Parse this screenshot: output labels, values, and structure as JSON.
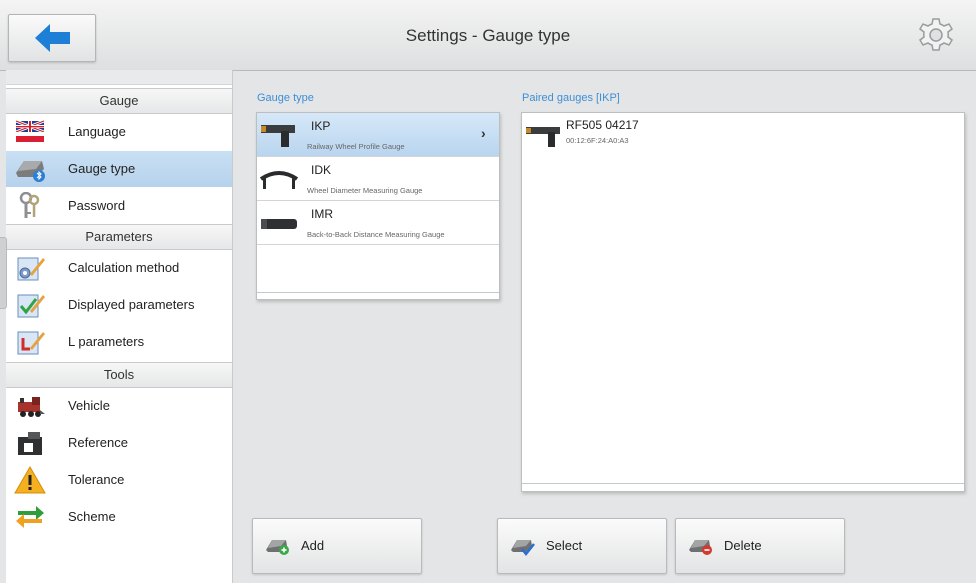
{
  "header": {
    "title": "Settings - Gauge type"
  },
  "sidebar": {
    "sections": [
      {
        "title": "Gauge",
        "items": [
          {
            "label": "Language",
            "icon": "uk-flag-icon"
          },
          {
            "label": "Gauge type",
            "icon": "gauge-bluetooth-icon",
            "selected": true
          },
          {
            "label": "Password",
            "icon": "keys-icon"
          }
        ]
      },
      {
        "title": "Parameters",
        "items": [
          {
            "label": "Calculation method",
            "icon": "calculation-method-icon"
          },
          {
            "label": "Displayed parameters",
            "icon": "displayed-parameters-icon"
          },
          {
            "label": "L parameters",
            "icon": "l-parameters-icon"
          }
        ]
      },
      {
        "title": "Tools",
        "items": [
          {
            "label": "Vehicle",
            "icon": "locomotive-icon"
          },
          {
            "label": "Reference",
            "icon": "reference-icon"
          },
          {
            "label": "Tolerance",
            "icon": "warning-icon"
          },
          {
            "label": "Scheme",
            "icon": "scheme-arrows-icon"
          }
        ]
      }
    ]
  },
  "gauge_type": {
    "label": "Gauge type",
    "items": [
      {
        "name": "IKP",
        "description": "Railway Wheel Profile Gauge",
        "selected": true
      },
      {
        "name": "IDK",
        "description": "Wheel Diameter Measuring Gauge"
      },
      {
        "name": "IMR",
        "description": "Back-to-Back Distance Measuring Gauge"
      }
    ]
  },
  "paired": {
    "label": "Paired gauges [IKP]",
    "items": [
      {
        "name": "RF505 04217",
        "mac": "00:12:6F:24:A0:A3"
      }
    ]
  },
  "actions": {
    "add": "Add",
    "select": "Select",
    "delete": "Delete"
  },
  "colors": {
    "accent": "#3d8fd6",
    "back_arrow": "#1e7fd6",
    "selected_row": "#bcd7ef"
  }
}
